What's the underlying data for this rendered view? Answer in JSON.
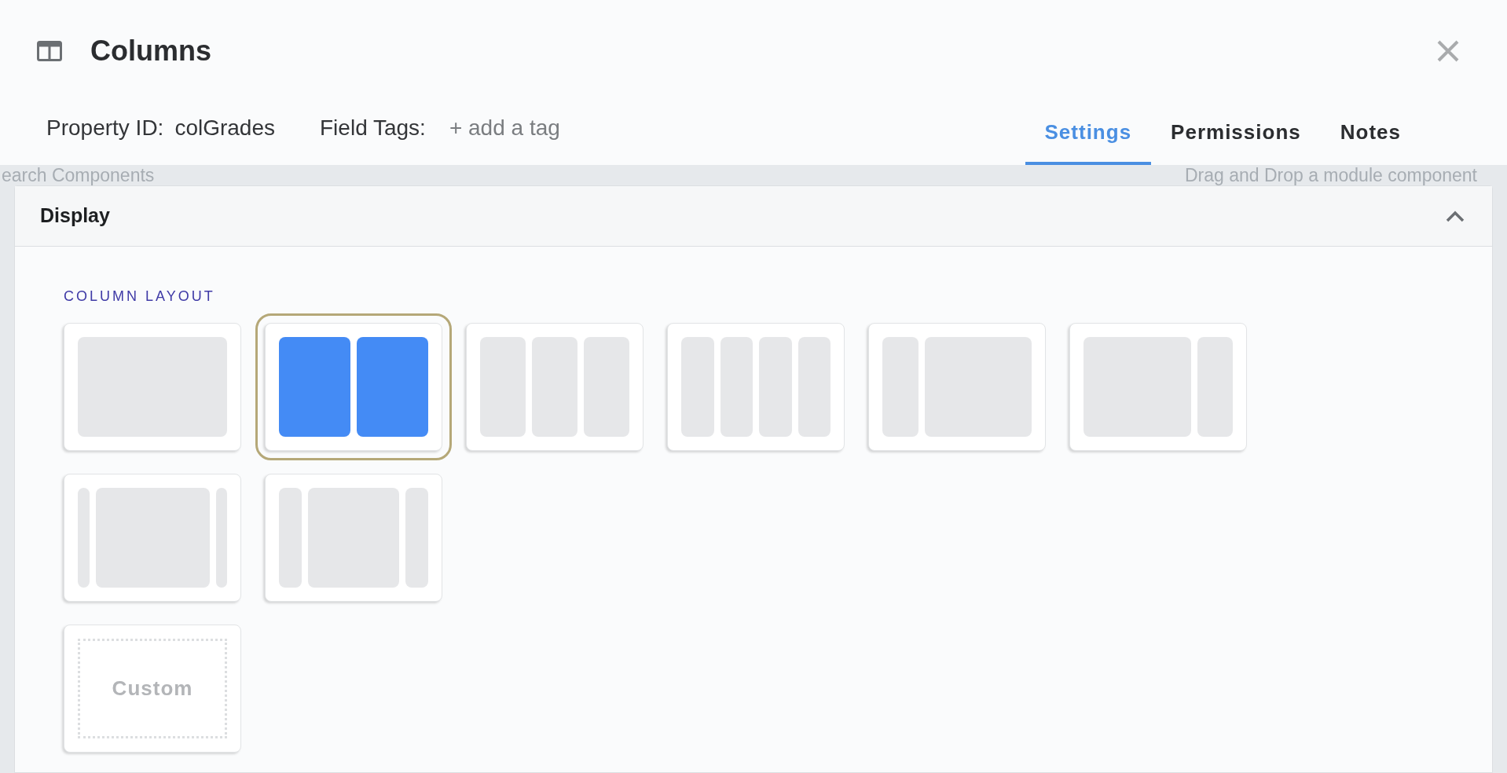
{
  "dialog": {
    "title": "Columns",
    "property_id_label": "Property ID:",
    "property_id": "colGrades",
    "field_tags_label": "Field Tags:",
    "field_tags_placeholder": "+ add a tag"
  },
  "tabs": [
    {
      "label": "Settings",
      "selected": true
    },
    {
      "label": "Permissions",
      "selected": false
    },
    {
      "label": "Notes",
      "selected": false
    }
  ],
  "background_texts": [
    "earch Components",
    "Drag and Drop a module component"
  ],
  "section": {
    "title": "Display",
    "expanded": true,
    "group_label": "COLUMN LAYOUT",
    "layouts": [
      {
        "kind": "single",
        "selected": false
      },
      {
        "kind": "halves",
        "selected": true
      },
      {
        "kind": "thirds",
        "selected": false
      },
      {
        "kind": "quarters",
        "selected": false
      },
      {
        "kind": "narrow-wide",
        "selected": false
      },
      {
        "kind": "wide-narrow",
        "selected": false
      },
      {
        "kind": "sidebars",
        "selected": false
      },
      {
        "kind": "wide-sidebars",
        "selected": false
      },
      {
        "kind": "custom",
        "label": "Custom",
        "selected": false
      }
    ]
  }
}
